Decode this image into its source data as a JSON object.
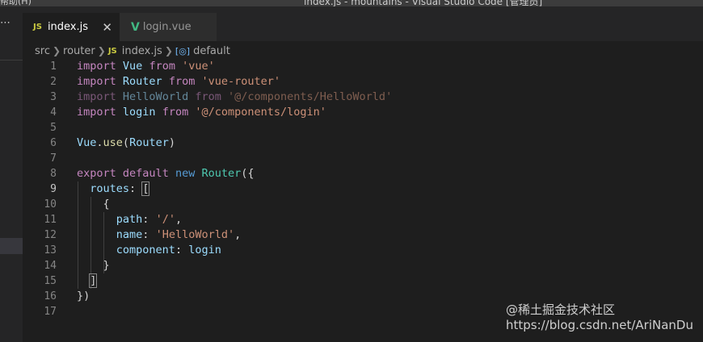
{
  "window": {
    "menu_fragment": "帮助(H)",
    "title": "index.js - mountains - Visual Studio Code [管理员]"
  },
  "sidebar": {
    "overflow_icon": "ellipsis-icon",
    "overflow_glyph": "⋯"
  },
  "tabs": [
    {
      "label": "index.js",
      "icon": "JS",
      "active": true,
      "close": "✕"
    },
    {
      "label": "login.vue",
      "icon": "V",
      "active": false
    }
  ],
  "breadcrumb": {
    "items": [
      "src",
      "router",
      "index.js",
      "default"
    ],
    "file_icon": "JS",
    "symbol_icon": "[◎]"
  },
  "editor": {
    "line_numbers": [
      "1",
      "2",
      "3",
      "4",
      "5",
      "6",
      "7",
      "8",
      "9",
      "10",
      "11",
      "12",
      "13",
      "14",
      "15",
      "16",
      "17"
    ],
    "current_line": 9,
    "lines": [
      [
        [
          "kw2",
          "import"
        ],
        [
          "pun",
          " "
        ],
        [
          "id",
          "Vue"
        ],
        [
          "pun",
          " "
        ],
        [
          "kw2",
          "from"
        ],
        [
          "pun",
          " "
        ],
        [
          "str",
          "'vue'"
        ]
      ],
      [
        [
          "kw2",
          "import"
        ],
        [
          "pun",
          " "
        ],
        [
          "id",
          "Router"
        ],
        [
          "pun",
          " "
        ],
        [
          "kw2",
          "from"
        ],
        [
          "pun",
          " "
        ],
        [
          "str",
          "'vue-router'"
        ]
      ],
      [
        [
          "kw2 faded",
          "import"
        ],
        [
          "pun",
          " "
        ],
        [
          "id faded",
          "HelloWorld"
        ],
        [
          "pun",
          " "
        ],
        [
          "kw2 faded",
          "from"
        ],
        [
          "pun",
          " "
        ],
        [
          "str faded",
          "'@/components/HelloWorld'"
        ]
      ],
      [
        [
          "kw2",
          "import"
        ],
        [
          "pun",
          " "
        ],
        [
          "id",
          "login"
        ],
        [
          "pun",
          " "
        ],
        [
          "kw2",
          "from"
        ],
        [
          "pun",
          " "
        ],
        [
          "str",
          "'@/components/login'"
        ]
      ],
      [],
      [
        [
          "id",
          "Vue"
        ],
        [
          "pun",
          "."
        ],
        [
          "fn",
          "use"
        ],
        [
          "pun",
          "("
        ],
        [
          "id",
          "Router"
        ],
        [
          "pun",
          ")"
        ]
      ],
      [],
      [
        [
          "kw2",
          "export"
        ],
        [
          "pun",
          " "
        ],
        [
          "kw2",
          "default"
        ],
        [
          "pun",
          " "
        ],
        [
          "kw",
          "new"
        ],
        [
          "pun",
          " "
        ],
        [
          "cls",
          "Router"
        ],
        [
          "pun",
          "({"
        ]
      ],
      [
        [
          "pun",
          "  "
        ],
        [
          "id",
          "routes"
        ],
        [
          "pun",
          ": "
        ],
        [
          "pun bracket-match",
          "["
        ]
      ],
      [
        [
          "pun",
          "    {"
        ]
      ],
      [
        [
          "pun",
          "      "
        ],
        [
          "id",
          "path"
        ],
        [
          "pun",
          ": "
        ],
        [
          "str",
          "'/'"
        ],
        [
          "pun",
          ","
        ]
      ],
      [
        [
          "pun",
          "      "
        ],
        [
          "id",
          "name"
        ],
        [
          "pun",
          ": "
        ],
        [
          "str",
          "'HelloWorld'"
        ],
        [
          "pun",
          ","
        ]
      ],
      [
        [
          "pun",
          "      "
        ],
        [
          "id",
          "component"
        ],
        [
          "pun",
          ": "
        ],
        [
          "id",
          "login"
        ]
      ],
      [
        [
          "pun",
          "    }"
        ]
      ],
      [
        [
          "pun",
          "  "
        ],
        [
          "pun bracket-match",
          "]"
        ]
      ],
      [
        [
          "pun",
          "})"
        ]
      ],
      []
    ]
  },
  "watermark": "@稀土掘金技术社区\nhttps://blog.csdn.net/AriNanDu",
  "watermark_lines": [
    "@稀土掘金技术社区",
    "https://blog.csdn.net/AriNanDu"
  ]
}
